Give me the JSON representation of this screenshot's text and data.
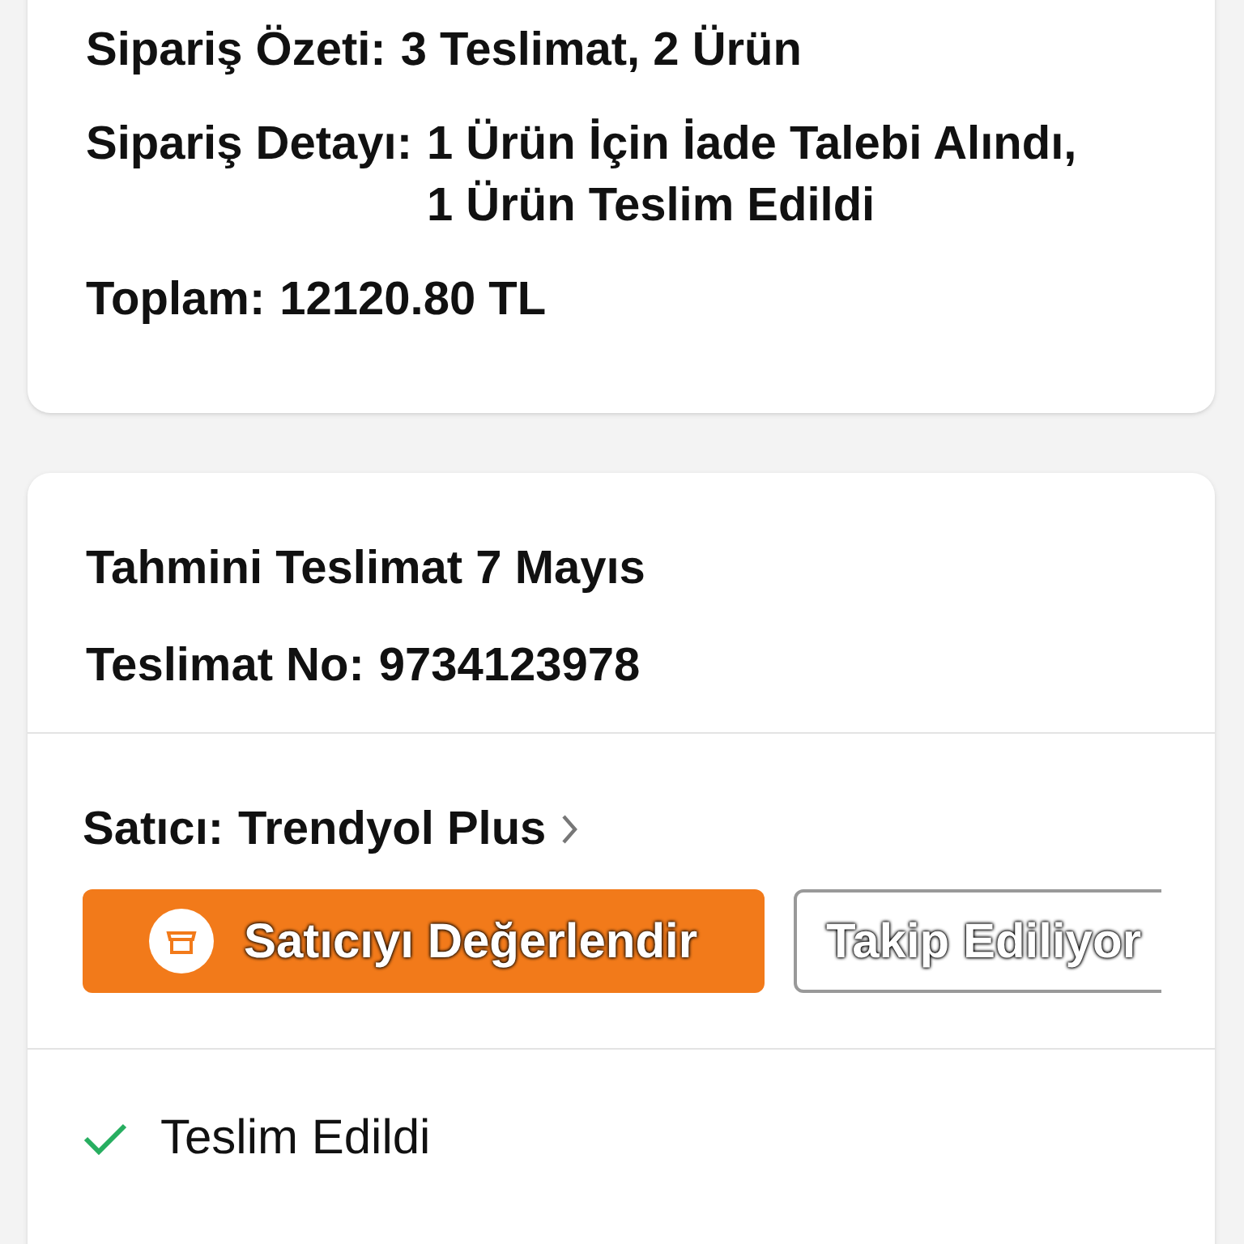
{
  "summary": {
    "rows": [
      {
        "label": "Sipariş Özeti:",
        "value": [
          "3 Teslimat, 2 Ürün"
        ]
      },
      {
        "label": "Sipariş Detayı:",
        "value": [
          "1 Ürün İçin İade Talebi Alındı,",
          "1 Ürün Teslim Edildi"
        ]
      },
      {
        "label": "Toplam:",
        "value": [
          "12120.80 TL"
        ]
      }
    ]
  },
  "delivery": {
    "estimate": "Tahmini Teslimat 7 Mayıs",
    "number_label": "Teslimat No:",
    "number": "9734123978",
    "seller": {
      "label": "Satıcı:",
      "name": "Trendyol Plus"
    },
    "buttons": [
      {
        "label": "Satıcıyı Değerlendir",
        "kind": "primary"
      },
      {
        "label": "Takip Ediliyor",
        "kind": "outline"
      }
    ],
    "status": {
      "label": "Teslim Edildi",
      "kind": "delivered"
    }
  }
}
